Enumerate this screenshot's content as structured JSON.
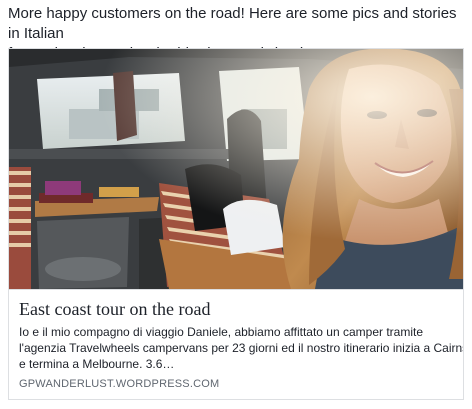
{
  "post": {
    "text_line1": "More happy customers on the road! Here are some pics and stories in Italian",
    "text_line2": "from a lovely couple who hired a travelwheels campervan"
  },
  "link_card": {
    "image_icon": "campervan-selfie-photo",
    "title": "East coast tour on the road",
    "description_line1": "Io e il mio compagno di viaggio Daniele, abbiamo affittato un camper tramite",
    "description_line2": "l'agenzia Travelwheels campervans per 23 giorni ed il nostro itinerario inizia a Cairns",
    "description_line3": "e termina a Melbourne. 3.6…",
    "domain": "GPWANDERLUST.WORDPRESS.COM"
  },
  "colors": {
    "text_primary": "#1d2129",
    "text_secondary": "#606770",
    "card_border": "#dddfe2"
  }
}
